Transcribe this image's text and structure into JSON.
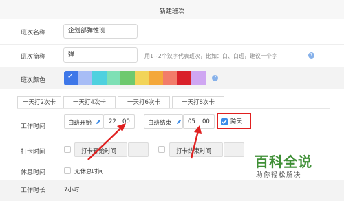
{
  "header": {
    "title": "新建班次"
  },
  "form": {
    "name": {
      "label": "班次名称",
      "value": "企划部弹性班"
    },
    "short_name": {
      "label": "班次简称",
      "value": "弹",
      "hint": "用1~2个汉字代表班次，比如：白、白班，建议一个字"
    },
    "color": {
      "label": "班次颜色",
      "swatches": [
        "#3e77e8",
        "#a8bdf6",
        "#4fd1df",
        "#7ee0b5",
        "#6ec96e",
        "#f2d459",
        "#f4a83b",
        "#f27c6a",
        "#d9212a",
        "#cfa6f2"
      ],
      "selected_index": 0
    },
    "tabs": [
      "一天打2次卡",
      "一天打4次卡",
      "一天打6次卡",
      "一天打8次卡"
    ],
    "work_time": {
      "label": "工作时间",
      "start_label": "白班开始",
      "start_hour": "22",
      "start_min": "00",
      "end_label": "白班结束",
      "end_hour": "05",
      "end_min": "00",
      "next_day_label": "跨天"
    },
    "punch": {
      "label": "打卡时间",
      "start_label": "打卡开始时间",
      "end_label": "打卡结束时间"
    },
    "rest": {
      "label": "休息时间",
      "option": "无休息时间"
    },
    "duration": {
      "label": "工作时长",
      "value": "7小时"
    }
  },
  "watermark": {
    "main": "百科全说",
    "sub": "助你轻松解决"
  },
  "icons": {
    "edit": "pencil-icon",
    "help": "question-icon",
    "check": "check-icon",
    "arrow": "red-arrow"
  },
  "colors": {
    "accent": "#3b8be8",
    "highlight": "#e02020"
  }
}
